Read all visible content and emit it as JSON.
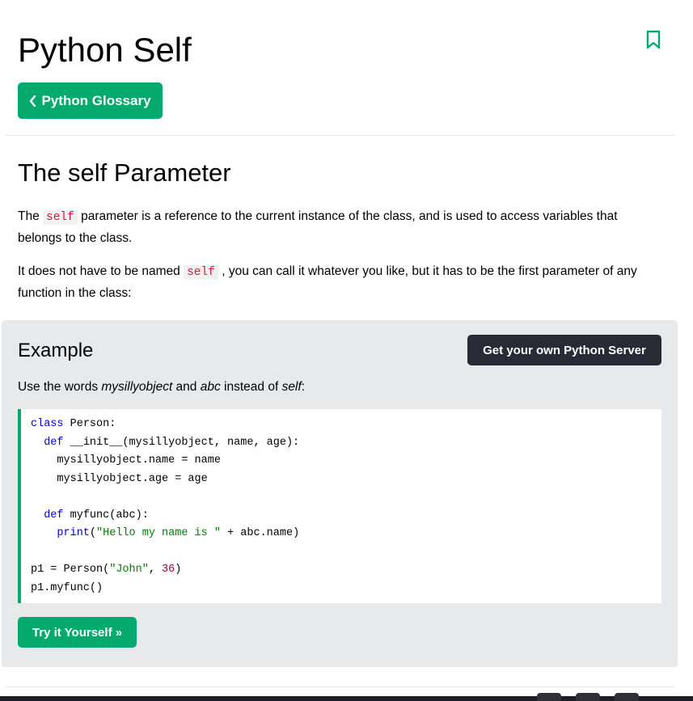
{
  "header": {
    "title": "Python Self",
    "back_button": "Python Glossary",
    "bookmark_icon": "bookmark-icon"
  },
  "section": {
    "heading": "The self Parameter",
    "para1": {
      "before": "The ",
      "code": "self",
      "after": " parameter is a reference to the current instance of the class, and is used to access variables that belongs to the class."
    },
    "para2": {
      "before": "It does not have to be named ",
      "code": "self",
      "after": " , you can call it whatever you like, but it has to be the first parameter of any function in the class:"
    }
  },
  "example": {
    "title": "Example",
    "server_button": "Get your own Python Server",
    "desc": {
      "t1": "Use the words ",
      "e1": "mysillyobject",
      "t2": " and ",
      "e2": "abc",
      "t3": " instead of ",
      "e3": "self",
      "t4": ":"
    },
    "code": {
      "l1_kw": "class",
      "l1_rest": " Person:",
      "l2_indent": "  ",
      "l2_kw": "def",
      "l2_rest": " __init__(mysillyobject, name, age):",
      "l3": "    mysillyobject.name = name",
      "l4": "    mysillyobject.age = age",
      "l6_indent": "  ",
      "l6_kw": "def",
      "l6_rest": " myfunc(abc):",
      "l7_indent": "    ",
      "l7_kw": "print",
      "l7_p1": "(",
      "l7_str": "\"Hello my name is \"",
      "l7_rest": " + abc.name)",
      "l9_pre": "p1 = Person(",
      "l9_str": "\"John\"",
      "l9_mid": ", ",
      "l9_num": "36",
      "l9_end": ")",
      "l10": "p1.myfunc()"
    },
    "try_button": "Try it Yourself »"
  },
  "colors": {
    "accent": "#04AA6D",
    "dark_button": "#282A35",
    "example_bg": "#e7e9eb",
    "inline_code": "#dc143c"
  }
}
